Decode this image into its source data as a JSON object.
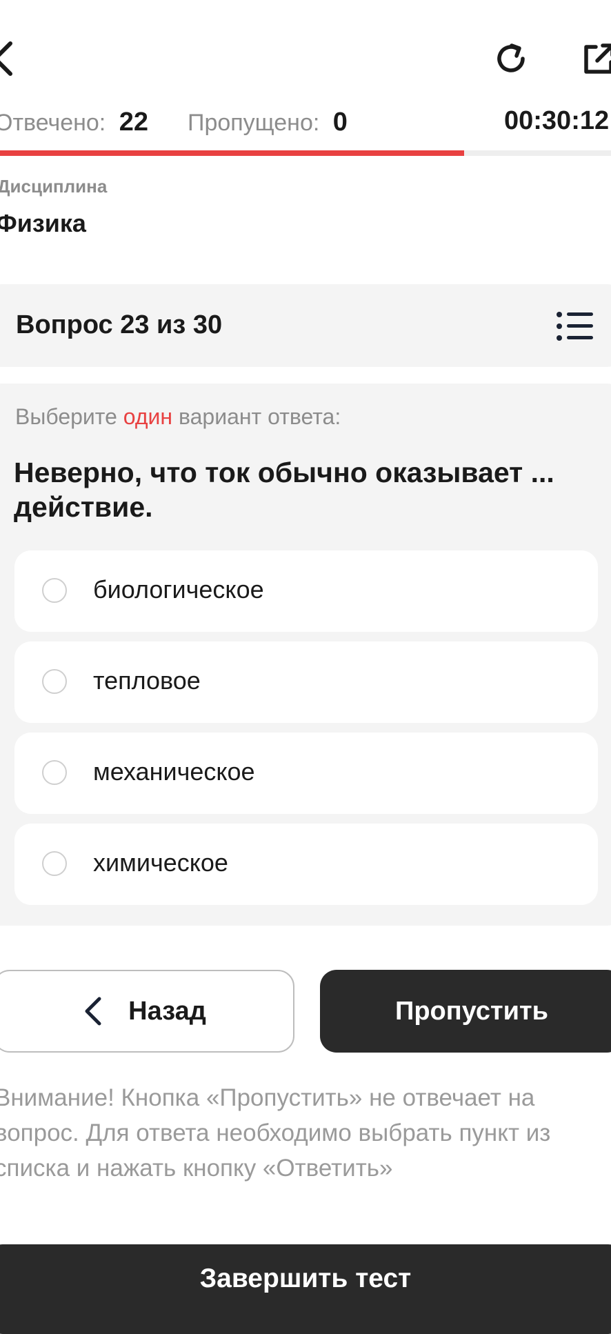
{
  "header": {
    "back_icon": "chevron-left-icon",
    "refresh_icon": "refresh-icon",
    "share_icon": "external-link-icon"
  },
  "stats": {
    "answered_label": "Отвечено:",
    "answered_value": "22",
    "skipped_label": "Пропущено:",
    "skipped_value": "0",
    "timer": "00:30:12"
  },
  "progress": {
    "fraction": 0.76,
    "fill_color": "#e84141",
    "track_color": "#eeeeee"
  },
  "discipline": {
    "label": "Дисциплина",
    "value": "Физика"
  },
  "question": {
    "number_text": "Вопрос 23 из 30",
    "list_icon": "list-icon",
    "instruction_before": "Выберите ",
    "instruction_accent": "один",
    "instruction_after": " вариант ответа:",
    "text": "Неверно, что ток обычно оказывает ... действие.",
    "options": [
      {
        "label": "биологическое",
        "selected": false
      },
      {
        "label": "тепловое",
        "selected": false
      },
      {
        "label": "механическое",
        "selected": false
      },
      {
        "label": "химическое",
        "selected": false
      }
    ]
  },
  "actions": {
    "back_label": "Назад",
    "skip_label": "Пропустить",
    "finish_label": "Завершить тест"
  },
  "warning": "Внимание! Кнопка «Пропустить» не отвечает на вопрос. Для ответа необходимо выбрать пункт из списка и нажать кнопку «Ответить»",
  "colors": {
    "accent": "#e84141",
    "dark_button": "#2a2a2a",
    "card_bg": "#f4f4f4"
  }
}
